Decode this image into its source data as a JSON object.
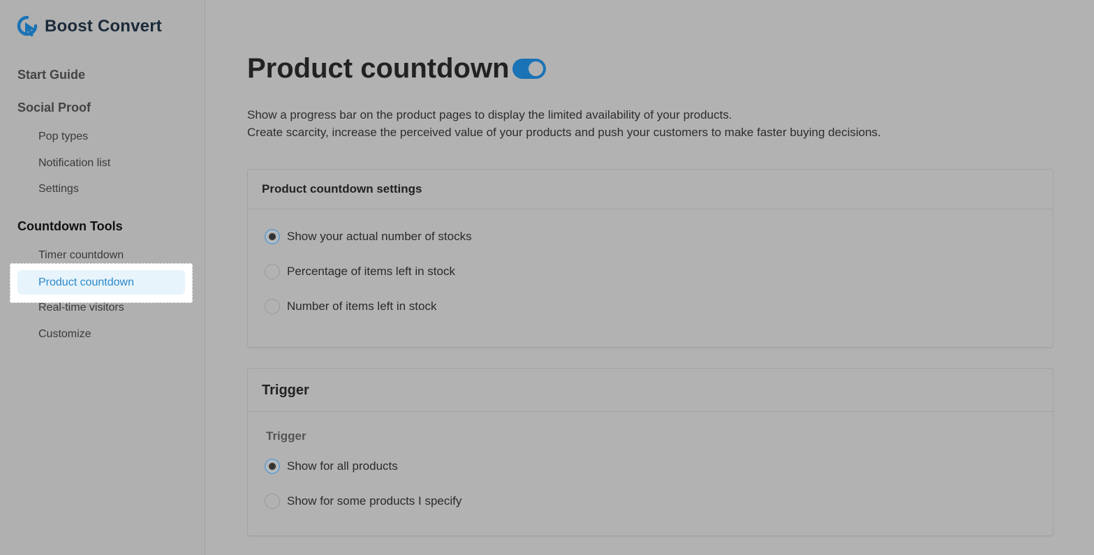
{
  "brand": {
    "name": "Boost Convert",
    "icon": "cursor-logo-icon",
    "color": "#1a73b5"
  },
  "sidebar": {
    "start_guide": "Start Guide",
    "social_proof": {
      "label": "Social Proof",
      "items": [
        "Pop types",
        "Notification list",
        "Settings"
      ]
    },
    "countdown_tools": {
      "label": "Countdown Tools",
      "items": [
        "Timer countdown",
        "Product countdown",
        "Real-time visitors",
        "Customize"
      ],
      "active": "Product countdown"
    }
  },
  "main": {
    "title": "Product countdown",
    "enabled": true,
    "description": [
      "Show a progress bar on the product pages to display the limited availability of your products.",
      "Create scarcity, increase the perceived value of your products and push your customers to make faster buying decisions."
    ],
    "settings_card": {
      "title": "Product countdown settings",
      "options": [
        {
          "label": "Show your actual number of stocks",
          "checked": true
        },
        {
          "label": "Percentage of items left in stock",
          "checked": false
        },
        {
          "label": "Number of items left in stock",
          "checked": false
        }
      ]
    },
    "trigger_card": {
      "title": "Trigger",
      "field_label": "Trigger",
      "options": [
        {
          "label": "Show for all products",
          "checked": true
        },
        {
          "label": "Show for some products I specify",
          "checked": false
        }
      ]
    }
  },
  "colors": {
    "accent": "#1a73b5",
    "active_nav_text": "#2a88c9",
    "active_nav_bg": "#e8f4fc"
  }
}
